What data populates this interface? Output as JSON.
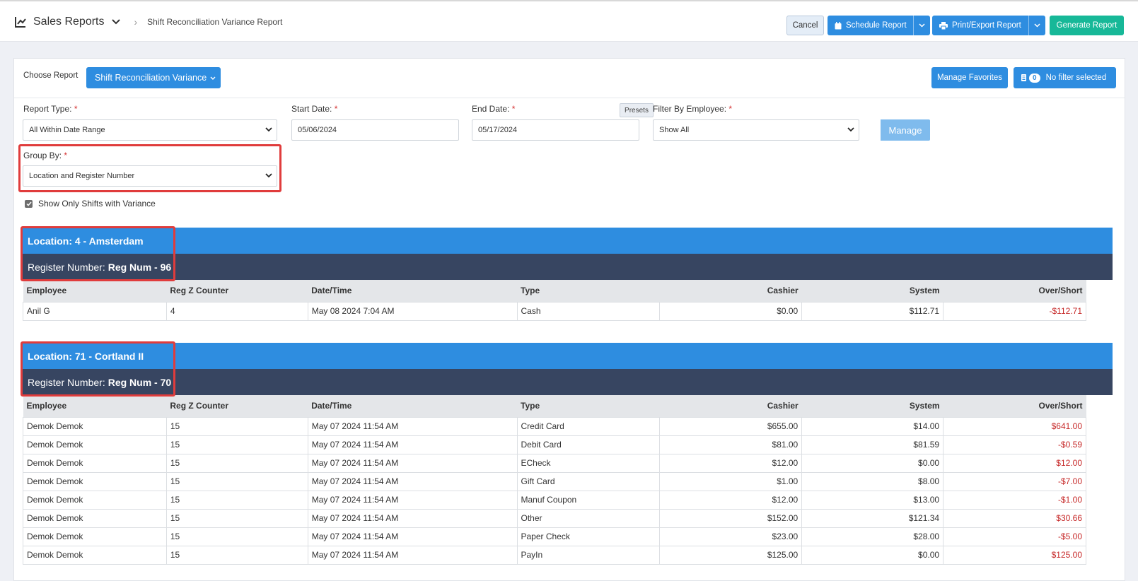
{
  "header": {
    "app_title": "Sales Reports",
    "breadcrumb": "Shift Reconciliation Variance Report",
    "cancel_label": "Cancel",
    "schedule_label": "Schedule Report",
    "print_label": "Print/Export Report",
    "generate_label": "Generate Report"
  },
  "toolbar": {
    "choose_label": "Choose Report",
    "choose_value": "Shift Reconciliation Variance",
    "manage_favorites_label": "Manage Favorites",
    "filter_count": "0",
    "filter_label": "No filter selected"
  },
  "filters": {
    "report_type_label": "Report Type:",
    "report_type_value": "All Within Date Range",
    "start_date_label": "Start Date:",
    "start_date_value": "05/06/2024",
    "end_date_label": "End Date:",
    "end_date_value": "05/17/2024",
    "presets_label": "Presets",
    "employee_label": "Filter By Employee:",
    "employee_value": "Show All",
    "manage_label": "Manage",
    "group_by_label": "Group By:",
    "group_by_value": "Location and Register Number",
    "variance_only_label": "Show Only Shifts with Variance",
    "variance_only_checked": true,
    "required_mark": "*"
  },
  "table_headers": [
    "Employee",
    "Reg Z Counter",
    "Date/Time",
    "Type",
    "Cashier",
    "System",
    "Over/Short"
  ],
  "sections": [
    {
      "location": "Location: 4 - Amsterdam",
      "register_label": "Register Number:",
      "register_value": "Reg Num - 96",
      "rows": [
        [
          "Anil G",
          "4",
          "May 08 2024 7:04 AM",
          "Cash",
          "$0.00",
          "$112.71",
          "-$112.71"
        ]
      ]
    },
    {
      "location": "Location: 71 - Cortland II",
      "register_label": "Register Number:",
      "register_value": "Reg Num - 70",
      "rows": [
        [
          "Demok Demok",
          "15",
          "May 07 2024 11:54 AM",
          "Credit Card",
          "$655.00",
          "$14.00",
          "$641.00"
        ],
        [
          "Demok Demok",
          "15",
          "May 07 2024 11:54 AM",
          "Debit Card",
          "$81.00",
          "$81.59",
          "-$0.59"
        ],
        [
          "Demok Demok",
          "15",
          "May 07 2024 11:54 AM",
          "ECheck",
          "$12.00",
          "$0.00",
          "$12.00"
        ],
        [
          "Demok Demok",
          "15",
          "May 07 2024 11:54 AM",
          "Gift Card",
          "$1.00",
          "$8.00",
          "-$7.00"
        ],
        [
          "Demok Demok",
          "15",
          "May 07 2024 11:54 AM",
          "Manuf Coupon",
          "$12.00",
          "$13.00",
          "-$1.00"
        ],
        [
          "Demok Demok",
          "15",
          "May 07 2024 11:54 AM",
          "Other",
          "$152.00",
          "$121.34",
          "$30.66"
        ],
        [
          "Demok Demok",
          "15",
          "May 07 2024 11:54 AM",
          "Paper Check",
          "$23.00",
          "$28.00",
          "-$5.00"
        ],
        [
          "Demok Demok",
          "15",
          "May 07 2024 11:54 AM",
          "PayIn",
          "$125.00",
          "$0.00",
          "$125.00"
        ]
      ]
    }
  ],
  "colors": {
    "primary": "#2e8de0",
    "register_bar": "#374561",
    "generate": "#17b898",
    "negative": "#c62828",
    "highlight": "#e03c3c"
  },
  "icons": [
    "line-chart-icon",
    "chevron-down-icon",
    "chevron-right-icon",
    "calendar-icon",
    "printer-icon",
    "filter-list-icon",
    "checkbox-check-icon"
  ]
}
